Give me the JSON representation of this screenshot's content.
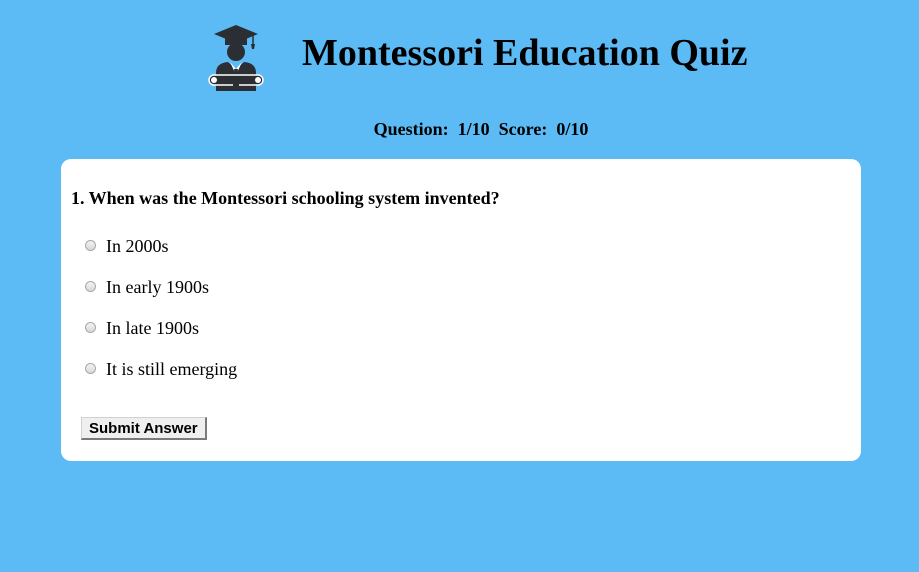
{
  "header": {
    "title": "Montessori Education Quiz",
    "icon": "graduate-icon"
  },
  "status": {
    "question_label": "Question:",
    "question_value": "1/10",
    "score_label": "Score:",
    "score_value": "0/10"
  },
  "quiz": {
    "question": "1. When was the Montessori schooling system invented?",
    "options": [
      {
        "label": "In 2000s"
      },
      {
        "label": "In early 1900s"
      },
      {
        "label": "In late 1900s"
      },
      {
        "label": "It is still emerging"
      }
    ],
    "submit_label": "Submit Answer"
  },
  "colors": {
    "background": "#5cbaf5",
    "card": "#ffffff",
    "icon": "#2b2f33"
  }
}
